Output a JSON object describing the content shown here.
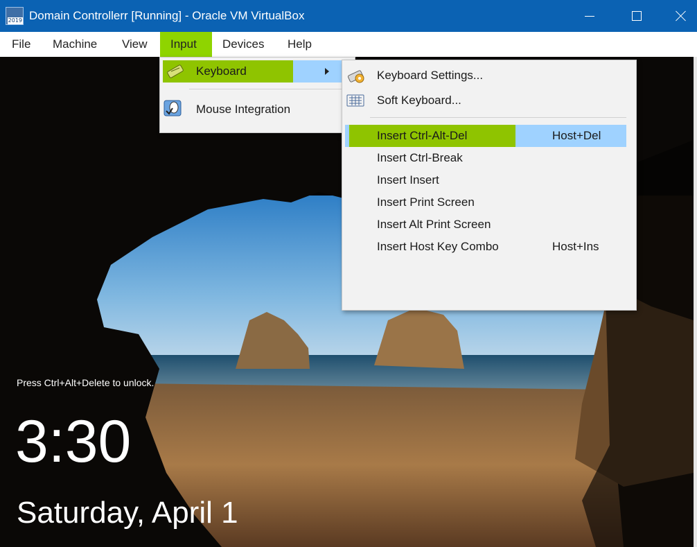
{
  "window": {
    "title": "Domain Controllerr [Running] - Oracle VM VirtualBox",
    "icon_badge": "2019"
  },
  "menubar": {
    "items": [
      "File",
      "Machine",
      "View",
      "Input",
      "Devices",
      "Help"
    ],
    "active": "Input"
  },
  "input_menu": {
    "items": [
      {
        "label": "Keyboard",
        "icon": "keyboard-icon",
        "has_submenu": true
      },
      {
        "label": "Mouse Integration",
        "icon": "mouse-integration-icon"
      }
    ]
  },
  "keyboard_menu": {
    "settings": [
      {
        "label": "Keyboard Settings...",
        "icon": "keyboard-settings-icon"
      },
      {
        "label": "Soft Keyboard...",
        "icon": "soft-keyboard-icon"
      }
    ],
    "actions": [
      {
        "label": "Insert Ctrl-Alt-Del",
        "shortcut": "Host+Del"
      },
      {
        "label": "Insert Ctrl-Break",
        "shortcut": ""
      },
      {
        "label": "Insert Insert",
        "shortcut": ""
      },
      {
        "label": "Insert Print Screen",
        "shortcut": ""
      },
      {
        "label": "Insert Alt Print Screen",
        "shortcut": ""
      },
      {
        "label": "Insert Host Key Combo",
        "shortcut": "Host+Ins"
      }
    ]
  },
  "lock_screen": {
    "hint": "Press Ctrl+Alt+Delete to unlock.",
    "time": "3:30",
    "date": "Saturday, April 1"
  },
  "colors": {
    "titlebar": "#0b62b3",
    "highlight_green": "#8fc400",
    "highlight_blue": "#9fd2ff"
  }
}
